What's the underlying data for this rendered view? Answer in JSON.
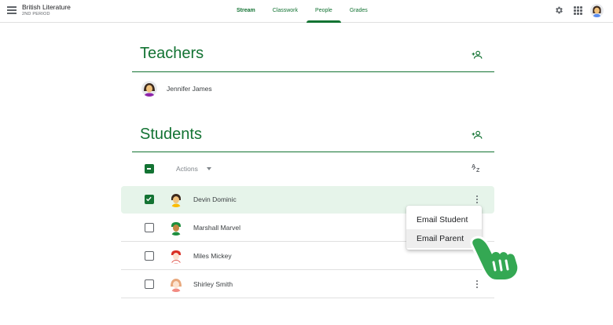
{
  "header": {
    "class_name": "British Literature",
    "class_period": "2ND PERIOD",
    "tabs": [
      {
        "label": "Stream"
      },
      {
        "label": "Classwork"
      },
      {
        "label": "People"
      },
      {
        "label": "Grades"
      }
    ],
    "active_tab": "People"
  },
  "teachers": {
    "title": "Teachers",
    "list": [
      {
        "name": "Jennifer James"
      }
    ]
  },
  "students": {
    "title": "Students",
    "actions_label": "Actions",
    "list": [
      {
        "name": "Devin Dominic",
        "selected": true
      },
      {
        "name": "Marshall Marvel",
        "selected": false
      },
      {
        "name": "Miles Mickey",
        "selected": false
      },
      {
        "name": "Shirley Smith",
        "selected": false
      }
    ]
  },
  "context_menu": {
    "items": [
      {
        "label": "Email Student"
      },
      {
        "label": "Email Parent"
      }
    ],
    "hovered_item": "Email Parent"
  },
  "colors": {
    "accent": "#137333",
    "selected_row": "#e6f4ea",
    "pointer_hand": "#34a853"
  },
  "icons": [
    "menu-icon",
    "gear-icon",
    "apps-icon",
    "add-person-icon",
    "sort-az-icon",
    "more-vert-icon",
    "pointer-hand-icon"
  ]
}
